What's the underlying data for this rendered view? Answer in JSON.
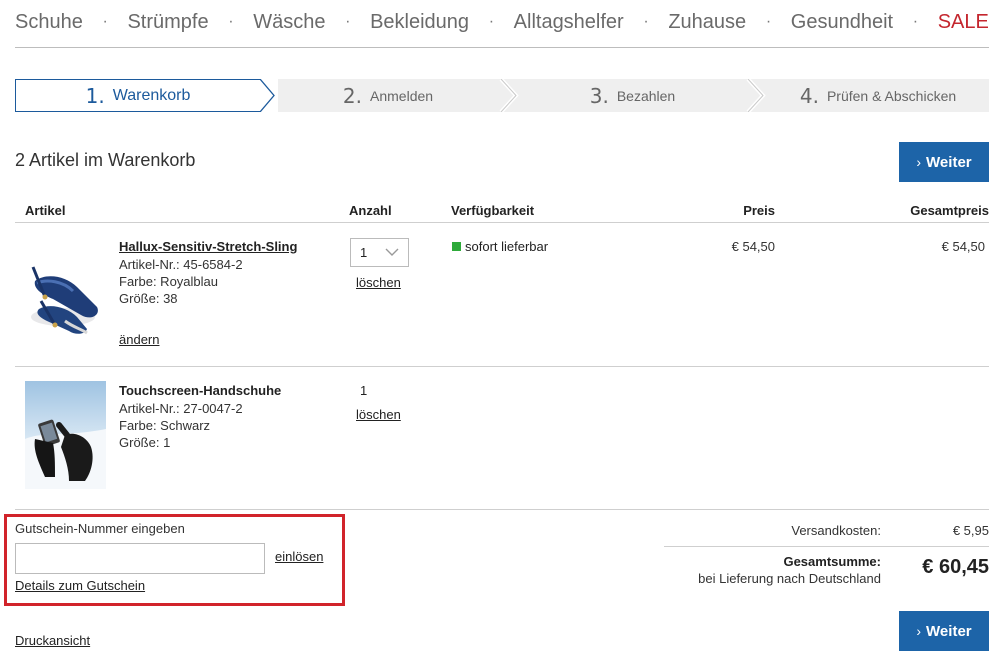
{
  "nav": {
    "items": [
      "Schuhe",
      "Strümpfe",
      "Wäsche",
      "Bekleidung",
      "Alltagshelfer",
      "Zuhause",
      "Gesundheit",
      "SALE"
    ],
    "separator": "·",
    "sale_color": "#c4262e"
  },
  "steps": [
    {
      "num": "1.",
      "label": "Warenkorb",
      "active": true
    },
    {
      "num": "2.",
      "label": "Anmelden",
      "active": false
    },
    {
      "num": "3.",
      "label": "Bezahlen",
      "active": false
    },
    {
      "num": "4.",
      "label": "Prüfen & Abschicken",
      "active": false
    }
  ],
  "cart": {
    "title": "2 Artikel im Warenkorb",
    "continue_label": "Weiter",
    "continue_chevron": "›",
    "columns": {
      "article": "Artikel",
      "quantity": "Anzahl",
      "availability": "Verfügbarkeit",
      "price": "Preis",
      "total": "Gesamtpreis"
    },
    "items": [
      {
        "name": "Hallux-Sensitiv-Stretch-Sling",
        "article_no": "Artikel-Nr.:  45-6584-2",
        "color": "Farbe: Royalblau",
        "size": "Größe: 38",
        "edit": "ändern",
        "quantity": "1",
        "delete": "löschen",
        "availability": "sofort lieferbar",
        "availability_color": "#2eaa3a",
        "price": "€ 54,50",
        "total": "€ 54,50"
      },
      {
        "name": "Touchscreen-Handschuhe",
        "article_no": "Artikel-Nr.:  27-0047-2",
        "color": "Farbe: Schwarz",
        "size": "Größe: 1",
        "quantity": "1",
        "delete": "löschen"
      }
    ]
  },
  "voucher": {
    "label": "Gutschein-Nummer eingeben",
    "input_value": "",
    "redeem": "einlösen",
    "details": "Details zum Gutschein",
    "highlight_color": "#d1232a"
  },
  "summary": {
    "shipping_label": "Versandkosten:",
    "shipping_value": "€ 5,95",
    "total_label": "Gesamtsumme:",
    "total_sub": "bei Lieferung nach Deutschland",
    "total_value": "€ 60,45"
  },
  "footer": {
    "print": "Druckansicht"
  },
  "theme": {
    "primary": "#1d64a8",
    "step_active": "#1c5a9c"
  }
}
